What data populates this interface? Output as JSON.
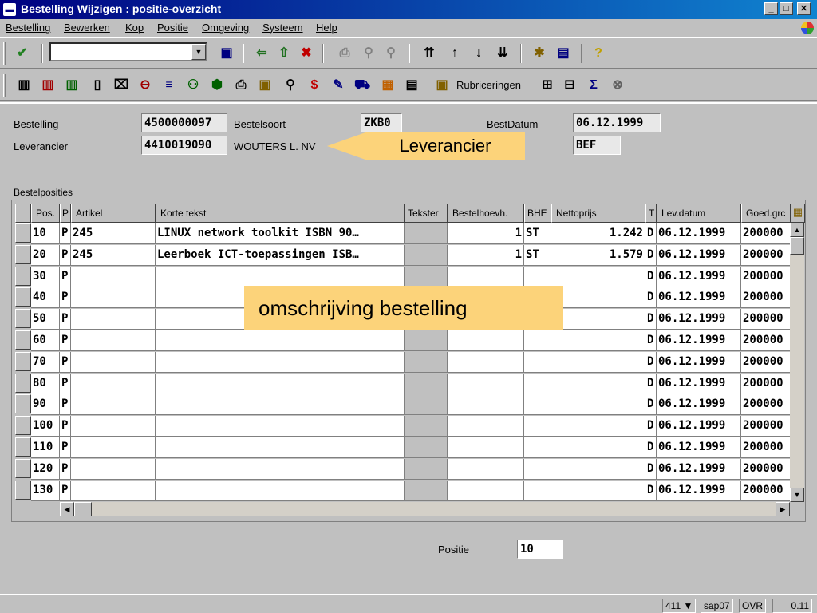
{
  "window": {
    "title": "Bestelling Wijzigen : positie-overzicht",
    "btn_min": "_",
    "btn_max": "□",
    "btn_close": "✕"
  },
  "menu": [
    "Bestelling",
    "Bewerken",
    "Kop",
    "Positie",
    "Omgeving",
    "Systeem",
    "Help"
  ],
  "toolbar2": {
    "rubriceringen": "Rubriceringen"
  },
  "header": {
    "bestelling_label": "Bestelling",
    "bestelling_value": "4500000097",
    "bestelsoort_label": "Bestelsoort",
    "bestelsoort_value": "ZKB0",
    "bestdatum_label": "BestDatum",
    "bestdatum_value": "06.12.1999",
    "leverancier_label": "Leverancier",
    "leverancier_value": "4410019090",
    "leverancier_name": "WOUTERS L. NV",
    "currency_value": "BEF"
  },
  "callouts": {
    "leverancier": "Leverancier",
    "omschrijving": "omschrijving bestelling"
  },
  "table": {
    "section_label": "Bestelposities",
    "columns": [
      "Pos.",
      "P",
      "Artikel",
      "Korte tekst",
      "Tekster",
      "Bestelhoevh.",
      "BHE",
      "Nettoprijs",
      "T",
      "Lev.datum",
      "Goed.grc"
    ],
    "rows": [
      {
        "pos": "10",
        "p": "P",
        "artikel": "245",
        "tekst": "LINUX network toolkit ISBN 90…",
        "qty": "1",
        "bhe": "ST",
        "prijs": "1.242",
        "t": "D",
        "datum": "06.12.1999",
        "goed": "200000"
      },
      {
        "pos": "20",
        "p": "P",
        "artikel": "245",
        "tekst": "Leerboek ICT-toepassingen ISB…",
        "qty": "1",
        "bhe": "ST",
        "prijs": "1.579",
        "t": "D",
        "datum": "06.12.1999",
        "goed": "200000"
      },
      {
        "pos": "30",
        "p": "P",
        "artikel": "",
        "tekst": "",
        "qty": "",
        "bhe": "",
        "prijs": "",
        "t": "D",
        "datum": "06.12.1999",
        "goed": "200000"
      },
      {
        "pos": "40",
        "p": "P",
        "artikel": "",
        "tekst": "",
        "qty": "",
        "bhe": "",
        "prijs": "",
        "t": "D",
        "datum": "06.12.1999",
        "goed": "200000"
      },
      {
        "pos": "50",
        "p": "P",
        "artikel": "",
        "tekst": "",
        "qty": "",
        "bhe": "",
        "prijs": "",
        "t": "D",
        "datum": "06.12.1999",
        "goed": "200000"
      },
      {
        "pos": "60",
        "p": "P",
        "artikel": "",
        "tekst": "",
        "qty": "",
        "bhe": "",
        "prijs": "",
        "t": "D",
        "datum": "06.12.1999",
        "goed": "200000"
      },
      {
        "pos": "70",
        "p": "P",
        "artikel": "",
        "tekst": "",
        "qty": "",
        "bhe": "",
        "prijs": "",
        "t": "D",
        "datum": "06.12.1999",
        "goed": "200000"
      },
      {
        "pos": "80",
        "p": "P",
        "artikel": "",
        "tekst": "",
        "qty": "",
        "bhe": "",
        "prijs": "",
        "t": "D",
        "datum": "06.12.1999",
        "goed": "200000"
      },
      {
        "pos": "90",
        "p": "P",
        "artikel": "",
        "tekst": "",
        "qty": "",
        "bhe": "",
        "prijs": "",
        "t": "D",
        "datum": "06.12.1999",
        "goed": "200000"
      },
      {
        "pos": "100",
        "p": "P",
        "artikel": "",
        "tekst": "",
        "qty": "",
        "bhe": "",
        "prijs": "",
        "t": "D",
        "datum": "06.12.1999",
        "goed": "200000"
      },
      {
        "pos": "110",
        "p": "P",
        "artikel": "",
        "tekst": "",
        "qty": "",
        "bhe": "",
        "prijs": "",
        "t": "D",
        "datum": "06.12.1999",
        "goed": "200000"
      },
      {
        "pos": "120",
        "p": "P",
        "artikel": "",
        "tekst": "",
        "qty": "",
        "bhe": "",
        "prijs": "",
        "t": "D",
        "datum": "06.12.1999",
        "goed": "200000"
      },
      {
        "pos": "130",
        "p": "P",
        "artikel": "",
        "tekst": "",
        "qty": "",
        "bhe": "",
        "prijs": "",
        "t": "D",
        "datum": "06.12.1999",
        "goed": "200000"
      }
    ]
  },
  "positie": {
    "label": "Positie",
    "value": "10"
  },
  "status": {
    "session": "411",
    "system": "sap07",
    "mode": "OVR",
    "time": "0.11"
  },
  "colors": {
    "callout": "#fcd37a",
    "titlebar": "#000080"
  }
}
